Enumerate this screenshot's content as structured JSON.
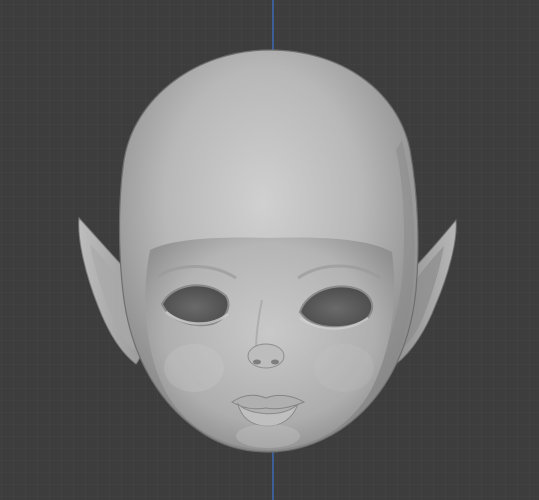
{
  "viewport": {
    "object_name": "doll-head",
    "colors": {
      "background": "#3d3d3d",
      "grid_minor": "#444444",
      "grid_major": "#474747",
      "axis_line": "#3e6dbb",
      "mesh_light": "#c4c4c4",
      "mesh_mid": "#a9a9a9",
      "mesh_shadow": "#7e7e7e",
      "eye_socket": "#5a5a5a"
    }
  }
}
